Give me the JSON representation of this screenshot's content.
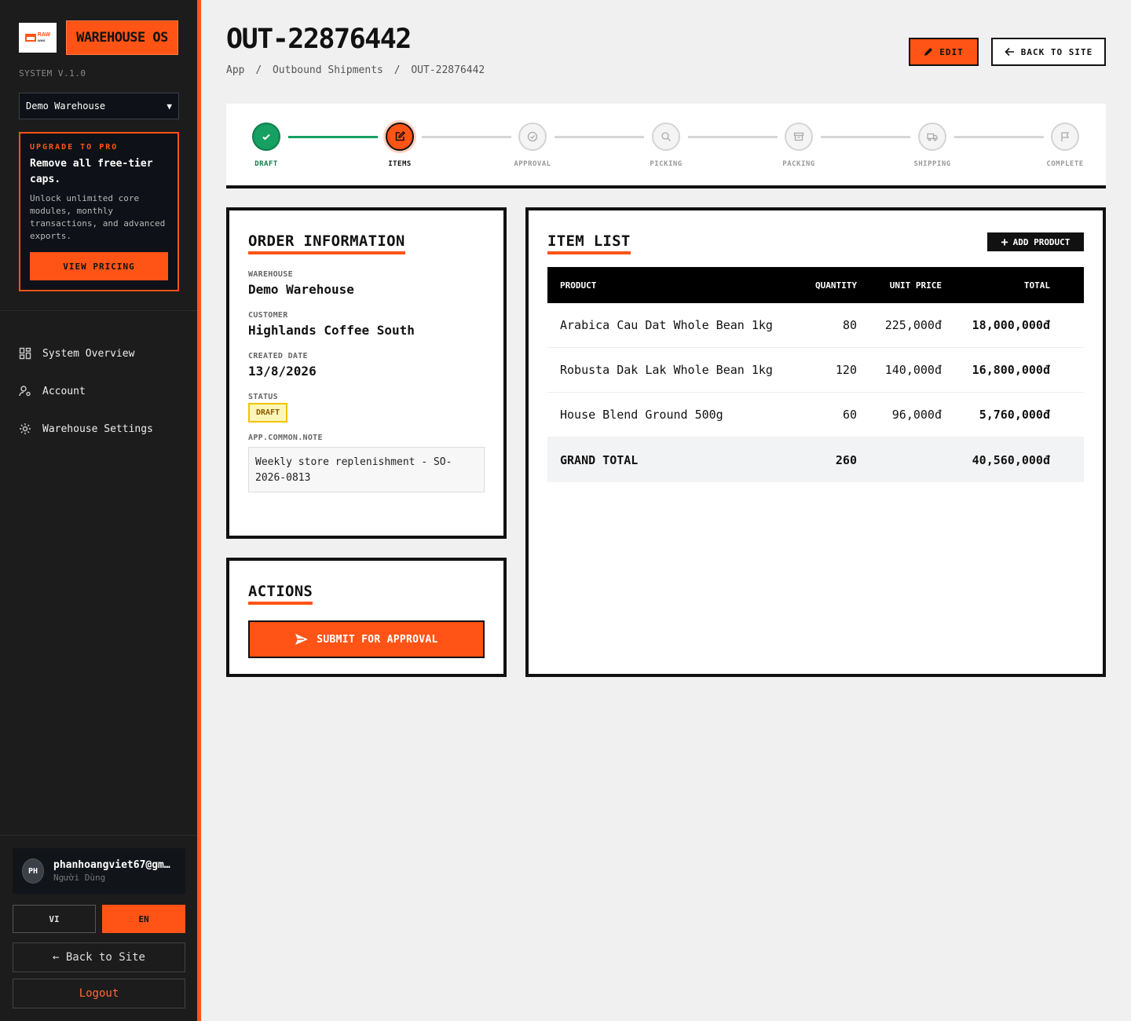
{
  "brand": {
    "logo_text": "RAW",
    "logo_sub": "WMS",
    "name": "WAREHOUSE OS",
    "version": "SYSTEM V.1.0"
  },
  "warehouse_select": {
    "value": "Demo Warehouse"
  },
  "upgrade": {
    "kicker": "UPGRADE TO PRO",
    "title": "Remove all free-tier caps.",
    "body": "Unlock unlimited core modules, monthly transactions, and advanced exports.",
    "button": "VIEW PRICING"
  },
  "nav": {
    "items": [
      {
        "label": "System Overview",
        "icon": "dashboard-icon"
      },
      {
        "label": "Account",
        "icon": "user-gear-icon"
      },
      {
        "label": "Warehouse Settings",
        "icon": "gear-icon"
      }
    ]
  },
  "user": {
    "initials": "PH",
    "name": "phanhoangviet67@gmail.com",
    "role": "Người Dùng"
  },
  "lang": {
    "vi": "VI",
    "en": "EN",
    "active": "EN"
  },
  "sidebar_footer": {
    "back": "← Back to Site",
    "logout": "Logout"
  },
  "header": {
    "title": "OUT-22876442",
    "breadcrumb": [
      "App",
      "/",
      "Outbound Shipments",
      "/",
      "OUT-22876442"
    ],
    "edit": "EDIT",
    "back": "BACK TO SITE"
  },
  "stepper": {
    "steps": [
      {
        "label": "DRAFT",
        "state": "done",
        "icon": "check-icon"
      },
      {
        "label": "ITEMS",
        "state": "active",
        "icon": "edit-icon"
      },
      {
        "label": "APPROVAL",
        "state": "pending",
        "icon": "check-circle-icon"
      },
      {
        "label": "PICKING",
        "state": "pending",
        "icon": "search-icon"
      },
      {
        "label": "PACKING",
        "state": "pending",
        "icon": "box-icon"
      },
      {
        "label": "SHIPPING",
        "state": "pending",
        "icon": "truck-icon"
      },
      {
        "label": "COMPLETE",
        "state": "pending",
        "icon": "flag-icon"
      }
    ]
  },
  "order_info": {
    "title": "ORDER INFORMATION",
    "warehouse_label": "WAREHOUSE",
    "warehouse": "Demo Warehouse",
    "customer_label": "CUSTOMER",
    "customer": "Highlands Coffee South",
    "created_label": "CREATED DATE",
    "created": "13/8/2026",
    "status_label": "STATUS",
    "status": "DRAFT",
    "note_label": "APP.COMMON.NOTE",
    "note": "Weekly store replenishment - SO-2026-0813"
  },
  "actions": {
    "title": "ACTIONS",
    "submit": "SUBMIT FOR APPROVAL"
  },
  "item_list": {
    "title": "ITEM LIST",
    "add": "ADD PRODUCT",
    "columns": [
      "PRODUCT",
      "QUANTITY",
      "UNIT PRICE",
      "TOTAL"
    ],
    "rows": [
      {
        "product": "Arabica Cau Dat Whole Bean 1kg",
        "qty": "80",
        "price": "225,000đ",
        "total": "18,000,000đ"
      },
      {
        "product": "Robusta Dak Lak Whole Bean 1kg",
        "qty": "120",
        "price": "140,000đ",
        "total": "16,800,000đ"
      },
      {
        "product": "House Blend Ground 500g",
        "qty": "60",
        "price": "96,000đ",
        "total": "5,760,000đ"
      }
    ],
    "footer": {
      "label": "GRAND TOTAL",
      "qty": "260",
      "total": "40,560,000đ"
    }
  },
  "colors": {
    "accent": "#ff5416",
    "sidebar": "#1c1c1c",
    "success": "#16a061",
    "badge_bg": "#fff6b8",
    "badge_border": "#f3c400"
  }
}
